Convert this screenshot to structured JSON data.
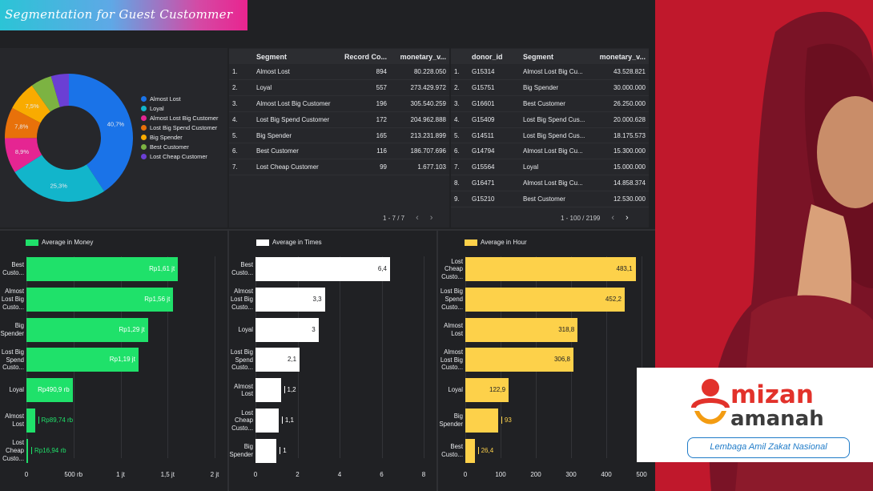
{
  "header": {
    "title": "Segmentation for Guest Custommer"
  },
  "donut": {
    "legend": [
      "Almost Lost",
      "Loyal",
      "Almost Lost Big Customer",
      "Lost Big Spend Customer",
      "Big Spender",
      "Best Customer",
      "Lost Cheap Customer"
    ],
    "colors": [
      "#1a73e8",
      "#12b5cb",
      "#e52592",
      "#e8710a",
      "#f9ab00",
      "#7cb342",
      "#6b3fd4"
    ],
    "pct_labels": [
      "40,7%",
      "25,3%",
      "8,9%",
      "7,8%",
      "7,5%",
      "",
      ""
    ]
  },
  "chart_data": [
    {
      "type": "pie",
      "categories": [
        "Almost Lost",
        "Loyal",
        "Almost Lost Big Customer",
        "Lost Big Spend Customer",
        "Big Spender",
        "Best Customer",
        "Lost Cheap Customer"
      ],
      "values": [
        40.7,
        25.3,
        8.9,
        7.8,
        7.5,
        5.3,
        4.5
      ]
    },
    {
      "type": "bar",
      "orientation": "horizontal",
      "legend": "Average in Money",
      "categories": [
        "Best Custo...",
        "Almost Lost Big Custo...",
        "Big Spender",
        "Lost Big Spend Custo...",
        "Loyal",
        "Almost Lost",
        "Lost Cheap Custo..."
      ],
      "values": [
        1610000,
        1560000,
        1290000,
        1190000,
        490900,
        89740,
        16940
      ],
      "value_labels": [
        "Rp1,61 jt",
        "Rp1,56 jt",
        "Rp1,29 jt",
        "Rp1,19 jt",
        "Rp490,9 rb",
        "Rp89,74 rb",
        "Rp16,94 rb"
      ],
      "xlim": [
        0,
        2000000
      ],
      "xticks": [
        "0",
        "500 rb",
        "1 jt",
        "1,5 jt",
        "2 jt"
      ],
      "color": "#1fe16a"
    },
    {
      "type": "bar",
      "orientation": "horizontal",
      "legend": "Average in Times",
      "categories": [
        "Best Custo...",
        "Almost Lost Big Custo...",
        "Loyal",
        "Lost Big Spend Custo...",
        "Almost Lost",
        "Lost Cheap Custo...",
        "Big Spender"
      ],
      "values": [
        6.4,
        3.3,
        3,
        2.1,
        1.2,
        1.1,
        1
      ],
      "value_labels": [
        "6,4",
        "3,3",
        "3",
        "2,1",
        "1,2",
        "1,1",
        "1"
      ],
      "xlim": [
        0,
        8
      ],
      "xticks": [
        "0",
        "2",
        "4",
        "6",
        "8"
      ],
      "color": "#ffffff"
    },
    {
      "type": "bar",
      "orientation": "horizontal",
      "legend": "Average in Hour",
      "categories": [
        "Lost Cheap Custo...",
        "Lost Big Spend Custo...",
        "Almost Lost",
        "Almost Lost Big Custo...",
        "Loyal",
        "Big Spender",
        "Best Custo..."
      ],
      "values": [
        483.1,
        452.2,
        318.8,
        306.8,
        122.9,
        93,
        26.4
      ],
      "value_labels": [
        "483,1",
        "452,2",
        "318,8",
        "306,8",
        "122,9",
        "93",
        "26,4"
      ],
      "xlim": [
        0,
        500
      ],
      "xticks": [
        "0",
        "100",
        "200",
        "300",
        "400",
        "500"
      ],
      "color": "#fdd14a"
    }
  ],
  "segment_table": {
    "headers": [
      "Segment",
      "Record Co...",
      "monetary_v..."
    ],
    "rows": [
      [
        "1.",
        "Almost Lost",
        "894",
        "80.228.050"
      ],
      [
        "2.",
        "Loyal",
        "557",
        "273.429.972"
      ],
      [
        "3.",
        "Almost Lost Big Customer",
        "196",
        "305.540.259"
      ],
      [
        "4.",
        "Lost Big Spend Customer",
        "172",
        "204.962.888"
      ],
      [
        "5.",
        "Big Spender",
        "165",
        "213.231.899"
      ],
      [
        "6.",
        "Best Customer",
        "116",
        "186.707.696"
      ],
      [
        "7.",
        "Lost Cheap Customer",
        "99",
        "1.677.103"
      ]
    ],
    "pager": "1 - 7 / 7"
  },
  "donor_table": {
    "headers": [
      "donor_id",
      "Segment",
      "monetary_v..."
    ],
    "rows": [
      [
        "1.",
        "G15314",
        "Almost Lost Big Cu...",
        "43.528.821"
      ],
      [
        "2.",
        "G15751",
        "Big Spender",
        "30.000.000"
      ],
      [
        "3.",
        "G16601",
        "Best Customer",
        "26.250.000"
      ],
      [
        "4.",
        "G15409",
        "Lost Big Spend Cus...",
        "20.000.628"
      ],
      [
        "5.",
        "G14511",
        "Lost Big Spend Cus...",
        "18.175.573"
      ],
      [
        "6.",
        "G14794",
        "Almost Lost Big Cu...",
        "15.300.000"
      ],
      [
        "7.",
        "G15564",
        "Loyal",
        "15.000.000"
      ],
      [
        "8.",
        "G16471",
        "Almost Lost Big Cu...",
        "14.858.374"
      ],
      [
        "9.",
        "G15210",
        "Best Customer",
        "12.530.000"
      ]
    ],
    "pager": "1 - 100 / 2199"
  },
  "logo": {
    "name1": "mizan",
    "name2": "amanah",
    "tagline": "Lembaga Amil Zakat Nasional"
  }
}
